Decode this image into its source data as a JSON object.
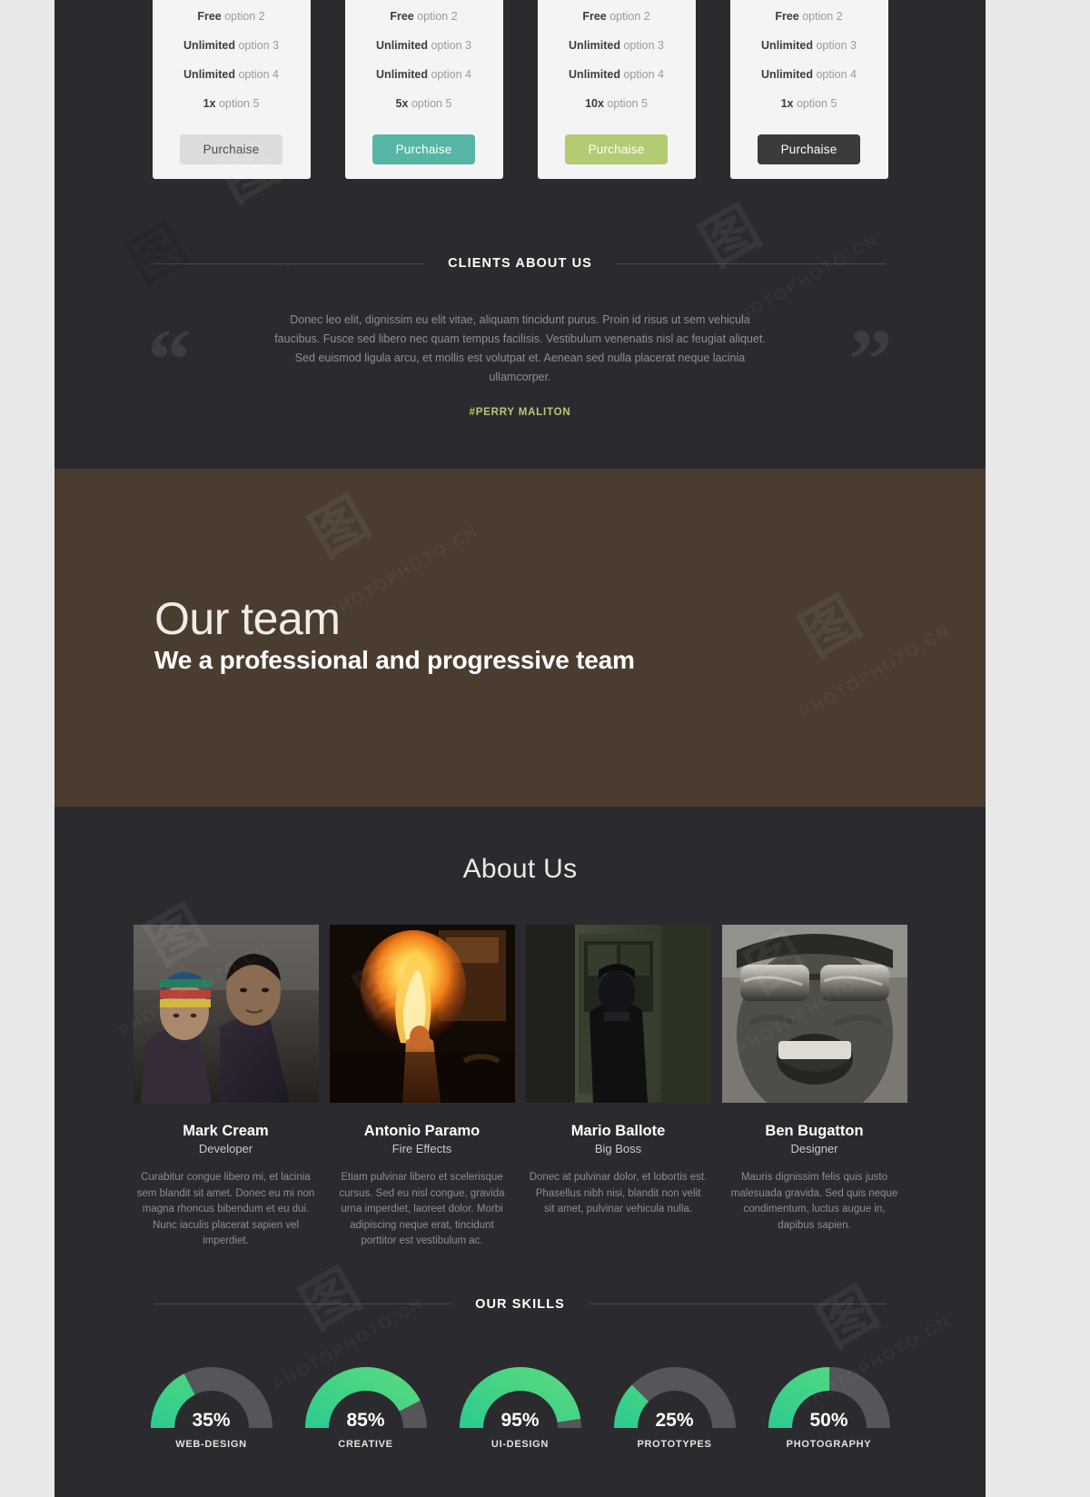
{
  "pricing": {
    "cards": [
      {
        "features": [
          {
            "strong": "Free",
            "rest": "option 2"
          },
          {
            "strong": "Unlimited",
            "rest": "option 3"
          },
          {
            "strong": "Unlimited",
            "rest": "option 4"
          },
          {
            "strong": "1x",
            "rest": "option 5"
          }
        ],
        "button": "Purchaise",
        "button_color": "#dcdcdc"
      },
      {
        "features": [
          {
            "strong": "Free",
            "rest": "option 2"
          },
          {
            "strong": "Unlimited",
            "rest": "option 3"
          },
          {
            "strong": "Unlimited",
            "rest": "option 4"
          },
          {
            "strong": "5x",
            "rest": "option 5"
          }
        ],
        "button": "Purchaise",
        "button_color": "#57b5a6"
      },
      {
        "features": [
          {
            "strong": "Free",
            "rest": "option 2"
          },
          {
            "strong": "Unlimited",
            "rest": "option 3"
          },
          {
            "strong": "Unlimited",
            "rest": "option 4"
          },
          {
            "strong": "10x",
            "rest": "option 5"
          }
        ],
        "button": "Purchaise",
        "button_color": "#b3cb72"
      },
      {
        "features": [
          {
            "strong": "Free",
            "rest": "option 2"
          },
          {
            "strong": "Unlimited",
            "rest": "option 3"
          },
          {
            "strong": "Unlimited",
            "rest": "option 4"
          },
          {
            "strong": "1x",
            "rest": "option 5"
          }
        ],
        "button": "Purchaise",
        "button_color": "#3b3b3b"
      }
    ]
  },
  "clients": {
    "heading": "CLIENTS ABOUT US",
    "quote_open": "“",
    "quote_close": "”",
    "quote": "Donec leo elit, dignissim eu elit vitae, aliquam tincidunt purus. Proin id risus ut sem vehicula faucibus. Fusce sed libero nec quam tempus facilisis. Vestibulum venenatis nisl ac feugiat aliquet. Sed euismod ligula arcu, et mollis est volutpat et. Aenean sed nulla placerat neque lacinia ullamcorper.",
    "author": "#PERRY MALITON",
    "author_color": "#b3cb72"
  },
  "team_banner": {
    "title": "Our team",
    "subtitle": "We a professional and progressive team",
    "background": "#4a3d30"
  },
  "about": {
    "title": "About Us",
    "members": [
      {
        "name": "Mark Cream",
        "role": "Developer",
        "bio": "Curabitur congue libero mi, et lacinia sem blandit sit amet. Donec eu mi non magna rhoncus bibendum et eu dui. Nunc iaculis placerat sapien vel imperdiet.",
        "photo": "man-holding-baby-photo"
      },
      {
        "name": "Antonio Paramo",
        "role": "Fire Effects",
        "bio": "Etiam pulvinar libero et scelerisque cursus. Sed eu nisl congue, gravida urna imperdiet, laoreet dolor. Morbi adipiscing neque erat, tincidunt porttitor est vestibulum ac.",
        "photo": "fire-breather-photo"
      },
      {
        "name": "Mario Ballote",
        "role": "Big Boss",
        "bio": "Donec at pulvinar dolor, et lobortis est. Phasellus nibh nisi, blandit non velit sit amet, pulvinar vehicula nulla.",
        "photo": "man-in-doorway-photo"
      },
      {
        "name": "Ben Bugatton",
        "role": "Designer",
        "bio": "Mauris dignissim felis quis justo malesuada gravida. Sed quis neque condimentum, luctus augue in, dapibus sapien.",
        "photo": "man-with-sunglasses-photo"
      }
    ]
  },
  "skills": {
    "heading": "OUR SKILLS"
  },
  "chart_data": {
    "type": "bar",
    "title": "OUR SKILLS",
    "categories": [
      "WEB-DESIGN",
      "CREATIVE",
      "UI-DESIGN",
      "PROTOTYPES",
      "PHOTOGRAPHY"
    ],
    "values": [
      35,
      85,
      95,
      25,
      50
    ],
    "value_labels": [
      "35%",
      "85%",
      "95%",
      "25%",
      "50%"
    ],
    "unit": "%",
    "ylim": [
      0,
      100
    ],
    "xlabel": "",
    "ylabel": "",
    "grid": false,
    "legend": false,
    "gauge_style": "semicircular-arc",
    "fill_color_start": "#2ecc8f",
    "fill_color_end": "#56d97f",
    "track_color": "#55555a"
  },
  "watermarks": {
    "text_cn": "图库网",
    "text_en": "PHOTOPHOTO.CN"
  }
}
